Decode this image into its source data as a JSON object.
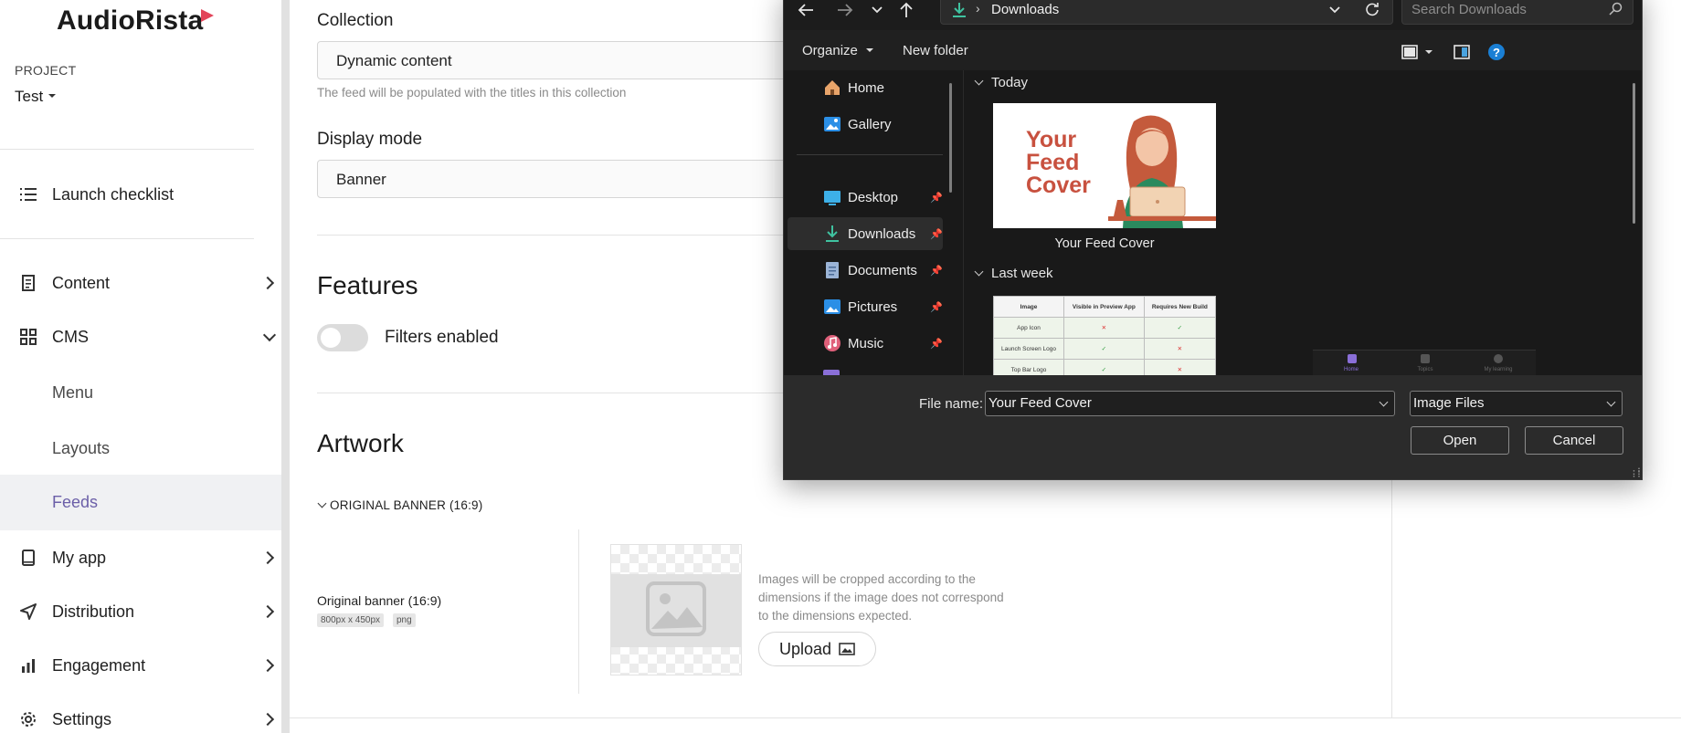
{
  "brand": {
    "name": "AudioRista",
    "accent": "#e2455a"
  },
  "project": {
    "label": "PROJECT",
    "value": "Test"
  },
  "sidebar": {
    "items": [
      {
        "label": "Launch checklist",
        "icon": "checklist-icon"
      },
      {
        "label": "Content",
        "icon": "document-icon"
      },
      {
        "label": "CMS",
        "icon": "grid-icon"
      },
      {
        "label": "Menu"
      },
      {
        "label": "Layouts"
      },
      {
        "label": "Feeds"
      },
      {
        "label": "My app",
        "icon": "phone-icon"
      },
      {
        "label": "Distribution",
        "icon": "send-icon"
      },
      {
        "label": "Engagement",
        "icon": "bar-chart-icon"
      },
      {
        "label": "Settings",
        "icon": "gear-icon"
      }
    ],
    "active_color": "#6b5fa8"
  },
  "main": {
    "collection": {
      "label": "Collection",
      "value": "Dynamic content",
      "hint": "The feed will be populated with the titles in this collection"
    },
    "display_mode": {
      "label": "Display mode",
      "value": "Banner"
    },
    "features": {
      "title": "Features",
      "toggle_label": "Filters enabled",
      "toggle_on": false
    },
    "artwork": {
      "title": "Artwork",
      "section": "ORIGINAL BANNER (16:9)",
      "item_title": "Original banner (16:9)",
      "tags": [
        "800px x 450px",
        "png"
      ],
      "note": "Images will be cropped according to the dimensions if the image does not correspond to the dimensions expected.",
      "upload_label": "Upload"
    }
  },
  "dialog": {
    "breadcrumb": "Downloads",
    "search_placeholder": "Search Downloads",
    "toolbar": {
      "organize": "Organize",
      "new_folder": "New folder"
    },
    "nav_pane": [
      {
        "label": "Home",
        "icon": "home-icon",
        "pinned": false
      },
      {
        "label": "Gallery",
        "icon": "gallery-icon",
        "pinned": false
      },
      {
        "label": "Desktop",
        "icon": "desktop-icon",
        "pinned": true
      },
      {
        "label": "Downloads",
        "icon": "download-icon",
        "pinned": true,
        "selected": true
      },
      {
        "label": "Documents",
        "icon": "documents-icon",
        "pinned": true
      },
      {
        "label": "Pictures",
        "icon": "pictures-icon",
        "pinned": true
      },
      {
        "label": "Music",
        "icon": "music-icon",
        "pinned": true
      }
    ],
    "groups": [
      {
        "label": "Today",
        "files": [
          {
            "name": "Your Feed Cover",
            "thumb_text": "Your Feed Cover"
          }
        ]
      },
      {
        "label": "Last week",
        "files": []
      }
    ],
    "thumb2_table": {
      "headers": [
        "Image",
        "Visible in Preview App",
        "Requires New Build"
      ],
      "rows": [
        [
          "App Icon",
          "✕",
          "✓"
        ],
        [
          "Launch Screen Logo",
          "✓",
          "✕"
        ],
        [
          "Top Bar Logo",
          "✓",
          "✕"
        ]
      ]
    },
    "thumb3_tabs": [
      "Home",
      "Topics",
      "My learning"
    ],
    "footer": {
      "file_name_label": "File name:",
      "file_name_value": "Your Feed Cover",
      "file_type": "Image Files",
      "open_label": "Open",
      "cancel_label": "Cancel"
    }
  }
}
